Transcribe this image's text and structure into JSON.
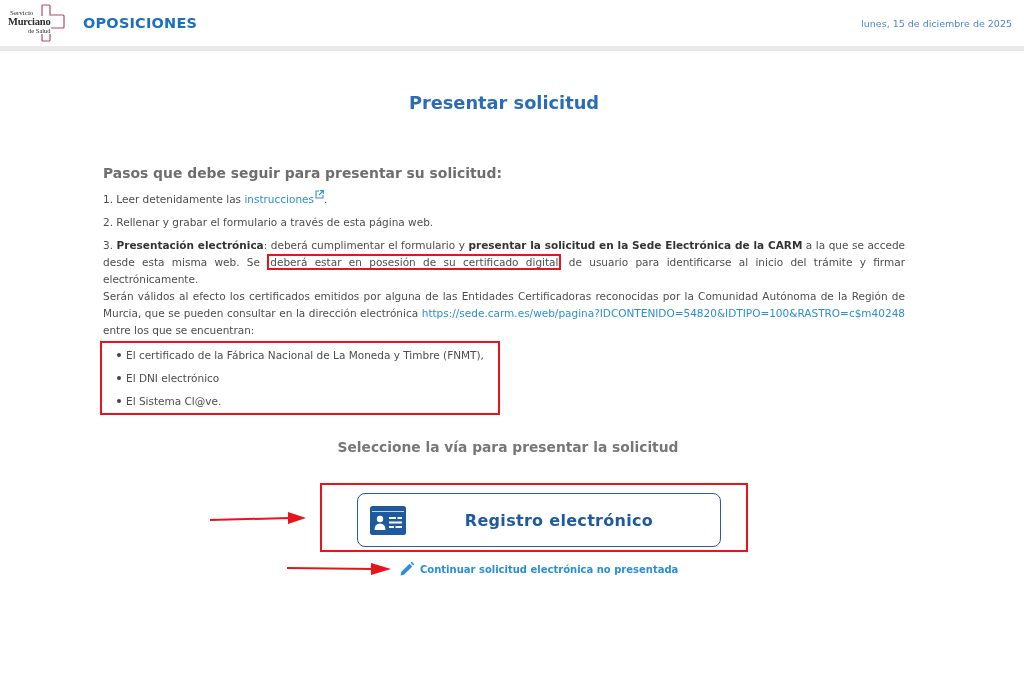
{
  "header": {
    "logo": {
      "lines": [
        "Servicio",
        "Murciano",
        "de Salud"
      ]
    },
    "title": "OPOSICIONES",
    "date": "lunes, 15 de diciembre de 2025"
  },
  "page_title": "Presentar solicitud",
  "instructions": {
    "heading": "Pasos que debe seguir para presentar su solicitud:",
    "steps": [
      {
        "paragraphs": [
          [
            {
              "kind": "text",
              "text": "1. Leer detenidamente las "
            },
            {
              "kind": "link",
              "text": "instrucciones",
              "external": true
            },
            {
              "kind": "text",
              "text": "."
            }
          ]
        ]
      },
      {
        "paragraphs": [
          [
            {
              "kind": "text",
              "text": "2. Rellenar y grabar el formulario a través de esta página web."
            }
          ]
        ]
      },
      {
        "paragraphs": [
          [
            {
              "kind": "text",
              "text": "3. **Presentación electrónica**: deberá cumplimentar el formulario y **presentar la solicitud en la Sede Electrónica de la CARM** a la que se accede desde esta misma web. Se "
            },
            {
              "kind": "highlight",
              "text": "deberá estar en posesión de su certificado digital"
            },
            {
              "kind": "text",
              "text": " de usuario para identificarse al inicio del trámite y firmar electrónicamente."
            }
          ],
          [
            {
              "kind": "text",
              "text": "Serán válidos al efecto los certificados emitidos por alguna de las Entidades Certificadoras reconocidas por la Comunidad Autónoma de la Región de Murcia, que se pueden consultar en la dirección electrónica "
            },
            {
              "kind": "link",
              "text": "https://sede.carm.es/web/pagina?IDCONTENIDO=54820&IDTIPO=100&RASTRO=c$m40248",
              "external": false
            },
            {
              "kind": "text",
              "text": " entre los que se encuentran:"
            }
          ]
        ]
      }
    ],
    "certificates": {
      "highlighted": true,
      "items": [
        "El certificado de la Fábrica Nacional de La Moneda y Timbre (FNMT),",
        "El DNI electrónico",
        "El Sistema Cl@ve."
      ]
    }
  },
  "submission": {
    "heading": "Seleccione la vía para presentar la solicitud",
    "register_button": {
      "label": "Registro electrónico",
      "highlighted": true,
      "arrow": true
    },
    "continue_link": {
      "label": "Continuar solicitud electrónica no presentada",
      "arrow": true
    }
  }
}
